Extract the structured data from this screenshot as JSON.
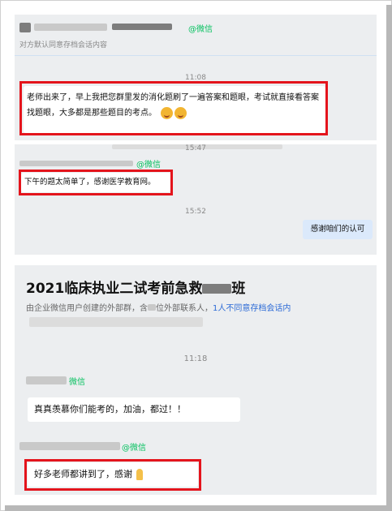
{
  "panel1": {
    "sender_badge": "@微信",
    "subtitle": "对方默认同意存档会话内容",
    "time": "11:08",
    "message": "老师出来了，早上我把您群里发的消化题刷了一遍答案和题眼，考试就直接看答案找题眼，大多都是那些题目的考点。"
  },
  "panel2": {
    "time_top": "15:47",
    "sender_badge": "@微信",
    "message": "下午的题太简单了，感谢医学教育网。",
    "time": "15:52",
    "reply": "感谢咱们的认可"
  },
  "panel3": {
    "group_title": "2021临床执业二试考前急救",
    "group_title_suffix": "班",
    "desc_prefix": "由企业微信用户创建的外部群，含",
    "desc_mid": "位外部联系人，",
    "desc_link": "1人不同意存档会话内",
    "time": "11:18",
    "sender_badge1": "微信",
    "message1": "真真羡慕你们能考的，加油，都过！！",
    "sender_badge2": "@微信",
    "message2": "好多老师都讲到了，感谢"
  },
  "colors": {
    "highlight_box": "#e4141c",
    "wechat_green": "#07c160",
    "link_blue": "#2d6bd6",
    "reply_bubble": "#dbe9fb"
  }
}
